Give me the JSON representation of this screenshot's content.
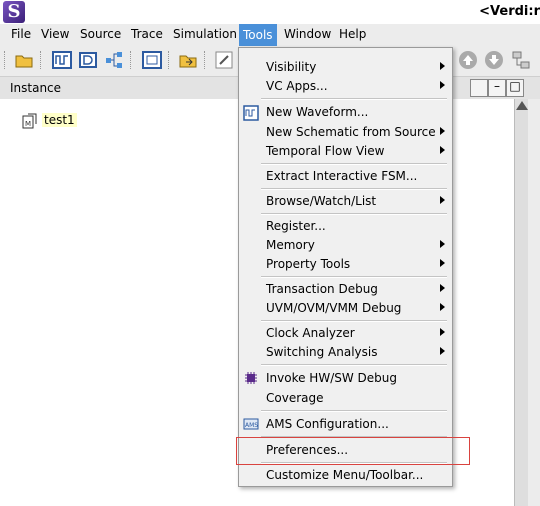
{
  "window": {
    "title": "<Verdi:r"
  },
  "menubar": {
    "items": [
      {
        "label": "File"
      },
      {
        "label": "View"
      },
      {
        "label": "Source"
      },
      {
        "label": "Trace"
      },
      {
        "label": "Simulation"
      },
      {
        "label": "Tools"
      },
      {
        "label": "Window"
      },
      {
        "label": "Help"
      }
    ]
  },
  "panel": {
    "title": "Instance"
  },
  "tree": {
    "root": "test1"
  },
  "tools_menu": {
    "items": [
      {
        "label": "Visibility",
        "submenu": true
      },
      {
        "label": "VC Apps...",
        "submenu": true
      },
      {
        "label": "New Waveform...",
        "submenu": false,
        "icon": "waveform-icon"
      },
      {
        "label": "New Schematic from Source",
        "submenu": true
      },
      {
        "label": "Temporal Flow View",
        "submenu": true
      },
      {
        "label": "Extract Interactive FSM...",
        "submenu": false
      },
      {
        "label": "Browse/Watch/List",
        "submenu": true
      },
      {
        "label": "Register...",
        "submenu": false
      },
      {
        "label": "Memory",
        "submenu": true
      },
      {
        "label": "Property Tools",
        "submenu": true
      },
      {
        "label": "Transaction Debug",
        "submenu": true
      },
      {
        "label": "UVM/OVM/VMM Debug",
        "submenu": true
      },
      {
        "label": "Clock Analyzer",
        "submenu": true
      },
      {
        "label": "Switching Analysis",
        "submenu": true
      },
      {
        "label": "Invoke HW/SW Debug",
        "submenu": false,
        "icon": "chip-icon"
      },
      {
        "label": "Coverage",
        "submenu": false
      },
      {
        "label": "AMS Configuration...",
        "submenu": false,
        "icon": "ams-icon"
      },
      {
        "label": "Preferences...",
        "submenu": false
      },
      {
        "label": "Customize Menu/Toolbar...",
        "submenu": false
      }
    ]
  },
  "colors": {
    "menu_active": "#4a90d9",
    "highlight": "#d9433f",
    "selection_bg": "#ffffc8"
  }
}
